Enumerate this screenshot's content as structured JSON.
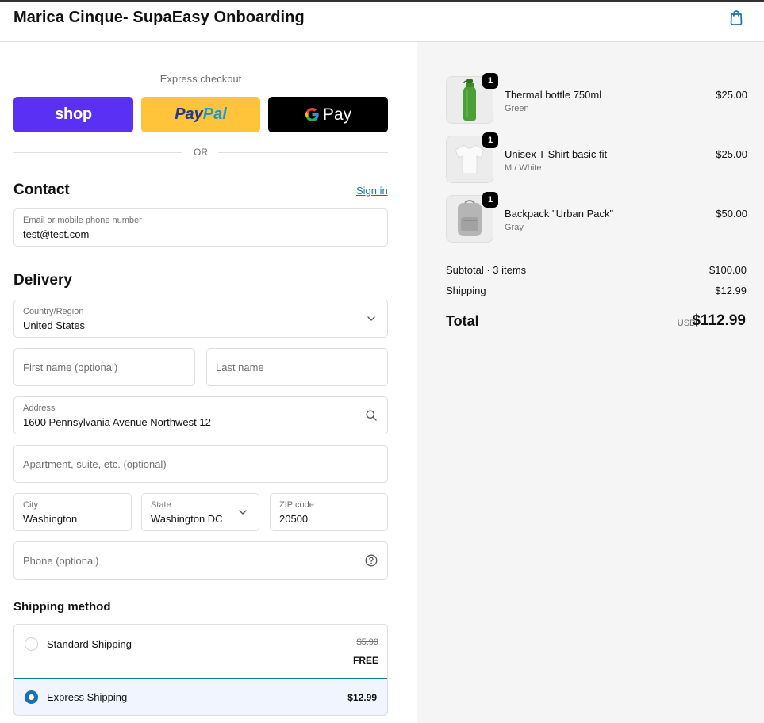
{
  "header": {
    "store_name": "Marica Cinque- SupaEasy Onboarding",
    "cart_icon": "shopping-bag-icon"
  },
  "express": {
    "label": "Express checkout",
    "shop_label": "shop",
    "paypal_label_1": "Pay",
    "paypal_label_2": "Pal",
    "gpay_label": "Pay",
    "or_label": "OR",
    "colors": {
      "shop": "#5a31f4",
      "paypal": "#ffc439",
      "gpay": "#000000"
    }
  },
  "contact": {
    "title": "Contact",
    "signin": "Sign in",
    "email_label": "Email or mobile phone number",
    "email_value": "test@test.com"
  },
  "delivery": {
    "title": "Delivery",
    "country_label": "Country/Region",
    "country_value": "United States",
    "first_name_placeholder": "First name (optional)",
    "last_name_placeholder": "Last name",
    "address_label": "Address",
    "address_value": "1600 Pennsylvania Avenue Northwest 12",
    "apartment_placeholder": "Apartment, suite, etc. (optional)",
    "city_label": "City",
    "city_value": "Washington",
    "state_label": "State",
    "state_value": "Washington DC",
    "zip_label": "ZIP code",
    "zip_value": "20500",
    "phone_placeholder": "Phone (optional)"
  },
  "shipping": {
    "title": "Shipping method",
    "standard": {
      "name": "Standard Shipping",
      "old_price": "$5.99",
      "price": "FREE",
      "selected": false
    },
    "express": {
      "name": "Express Shipping",
      "price": "$12.99",
      "selected": true
    }
  },
  "cart": {
    "items": [
      {
        "name": "Thermal bottle 750ml",
        "variant": "Green",
        "price": "$25.00",
        "qty": "1",
        "image": "green-bottle"
      },
      {
        "name": "Unisex T-Shirt basic fit",
        "variant": "M / White",
        "price": "$25.00",
        "qty": "1",
        "image": "white-tshirt"
      },
      {
        "name": "Backpack \"Urban Pack\"",
        "variant": "Gray",
        "price": "$50.00",
        "qty": "1",
        "image": "gray-backpack"
      }
    ],
    "subtotal_label": "Subtotal · 3 items",
    "subtotal_value": "$100.00",
    "shipping_label": "Shipping",
    "shipping_value": "$12.99",
    "total_label": "Total",
    "currency": "USD",
    "total_value": "$112.99"
  },
  "colors": {
    "accent": "#1773b0",
    "panel_bg": "#f5f5f5"
  }
}
